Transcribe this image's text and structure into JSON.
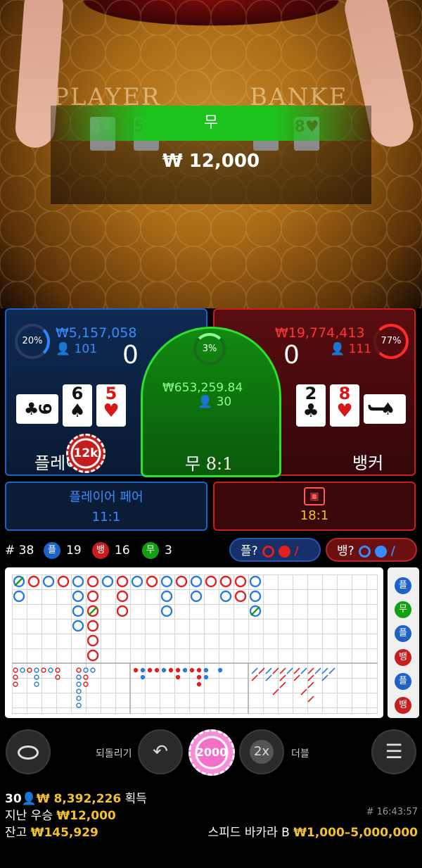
{
  "video": {
    "felt_player": "PLAYER",
    "felt_banker": "BANKE",
    "result_label": "무",
    "win_amount": "₩ 12,000",
    "player_cards_on_table": [
      "6♠",
      "5♥"
    ],
    "banker_cards_on_table": [
      "2♣",
      "8♥"
    ]
  },
  "player": {
    "percent": "20%",
    "amount": "₩5,157,058",
    "count": "101",
    "score": "0",
    "label": "플레이어",
    "cards": [
      {
        "rank": "9",
        "suit": "♣",
        "color": "black",
        "rotated": true
      },
      {
        "rank": "6",
        "suit": "♠",
        "color": "black",
        "rotated": false
      },
      {
        "rank": "5",
        "suit": "♥",
        "color": "red",
        "rotated": false
      }
    ],
    "chip": "12k"
  },
  "tie": {
    "percent": "3%",
    "amount": "₩653,259.84",
    "count": "30",
    "label": "무 8:1"
  },
  "banker": {
    "percent": "77%",
    "amount": "₩19,774,413",
    "count": "111",
    "score": "0",
    "label": "뱅커",
    "cards": [
      {
        "rank": "2",
        "suit": "♣",
        "color": "black",
        "rotated": false
      },
      {
        "rank": "8",
        "suit": "♥",
        "color": "red",
        "rotated": false
      },
      {
        "rank": "J",
        "suit": "♠",
        "color": "black",
        "rotated": true
      }
    ]
  },
  "pairs": {
    "player_pair_label": "플레이어 페어",
    "player_pair_odds": "11:1",
    "banker_pair_odds": "18:1"
  },
  "stats": {
    "round": "# 38",
    "player_badge": "플",
    "player_count": "19",
    "banker_badge": "뱅",
    "banker_count": "16",
    "tie_badge": "무",
    "tie_count": "3",
    "player_predict": "플?",
    "banker_predict": "뱅?"
  },
  "side_road": [
    "플",
    "무",
    "플",
    "뱅",
    "플",
    "뱅"
  ],
  "controls": {
    "undo_label": "되돌리기",
    "chip_value": "2000",
    "double_icon": "2x",
    "double_label": "더블"
  },
  "footer": {
    "players": "30",
    "total_won": "₩ 8,392,226",
    "won_suffix": "획득",
    "last_win_label": "지난 우승",
    "last_win_amount": "₩12,000",
    "balance_label": "잔고",
    "balance_amount": "₩145,929",
    "round_time": "# 16:43:57",
    "table_name": "스피드 바카라 B",
    "limits": "₩1,000–5,000,000"
  },
  "colors": {
    "player_blue": "#1e62c8",
    "banker_red": "#c81e1e",
    "tie_green": "#2ee02e",
    "gold": "#f2c12e"
  }
}
